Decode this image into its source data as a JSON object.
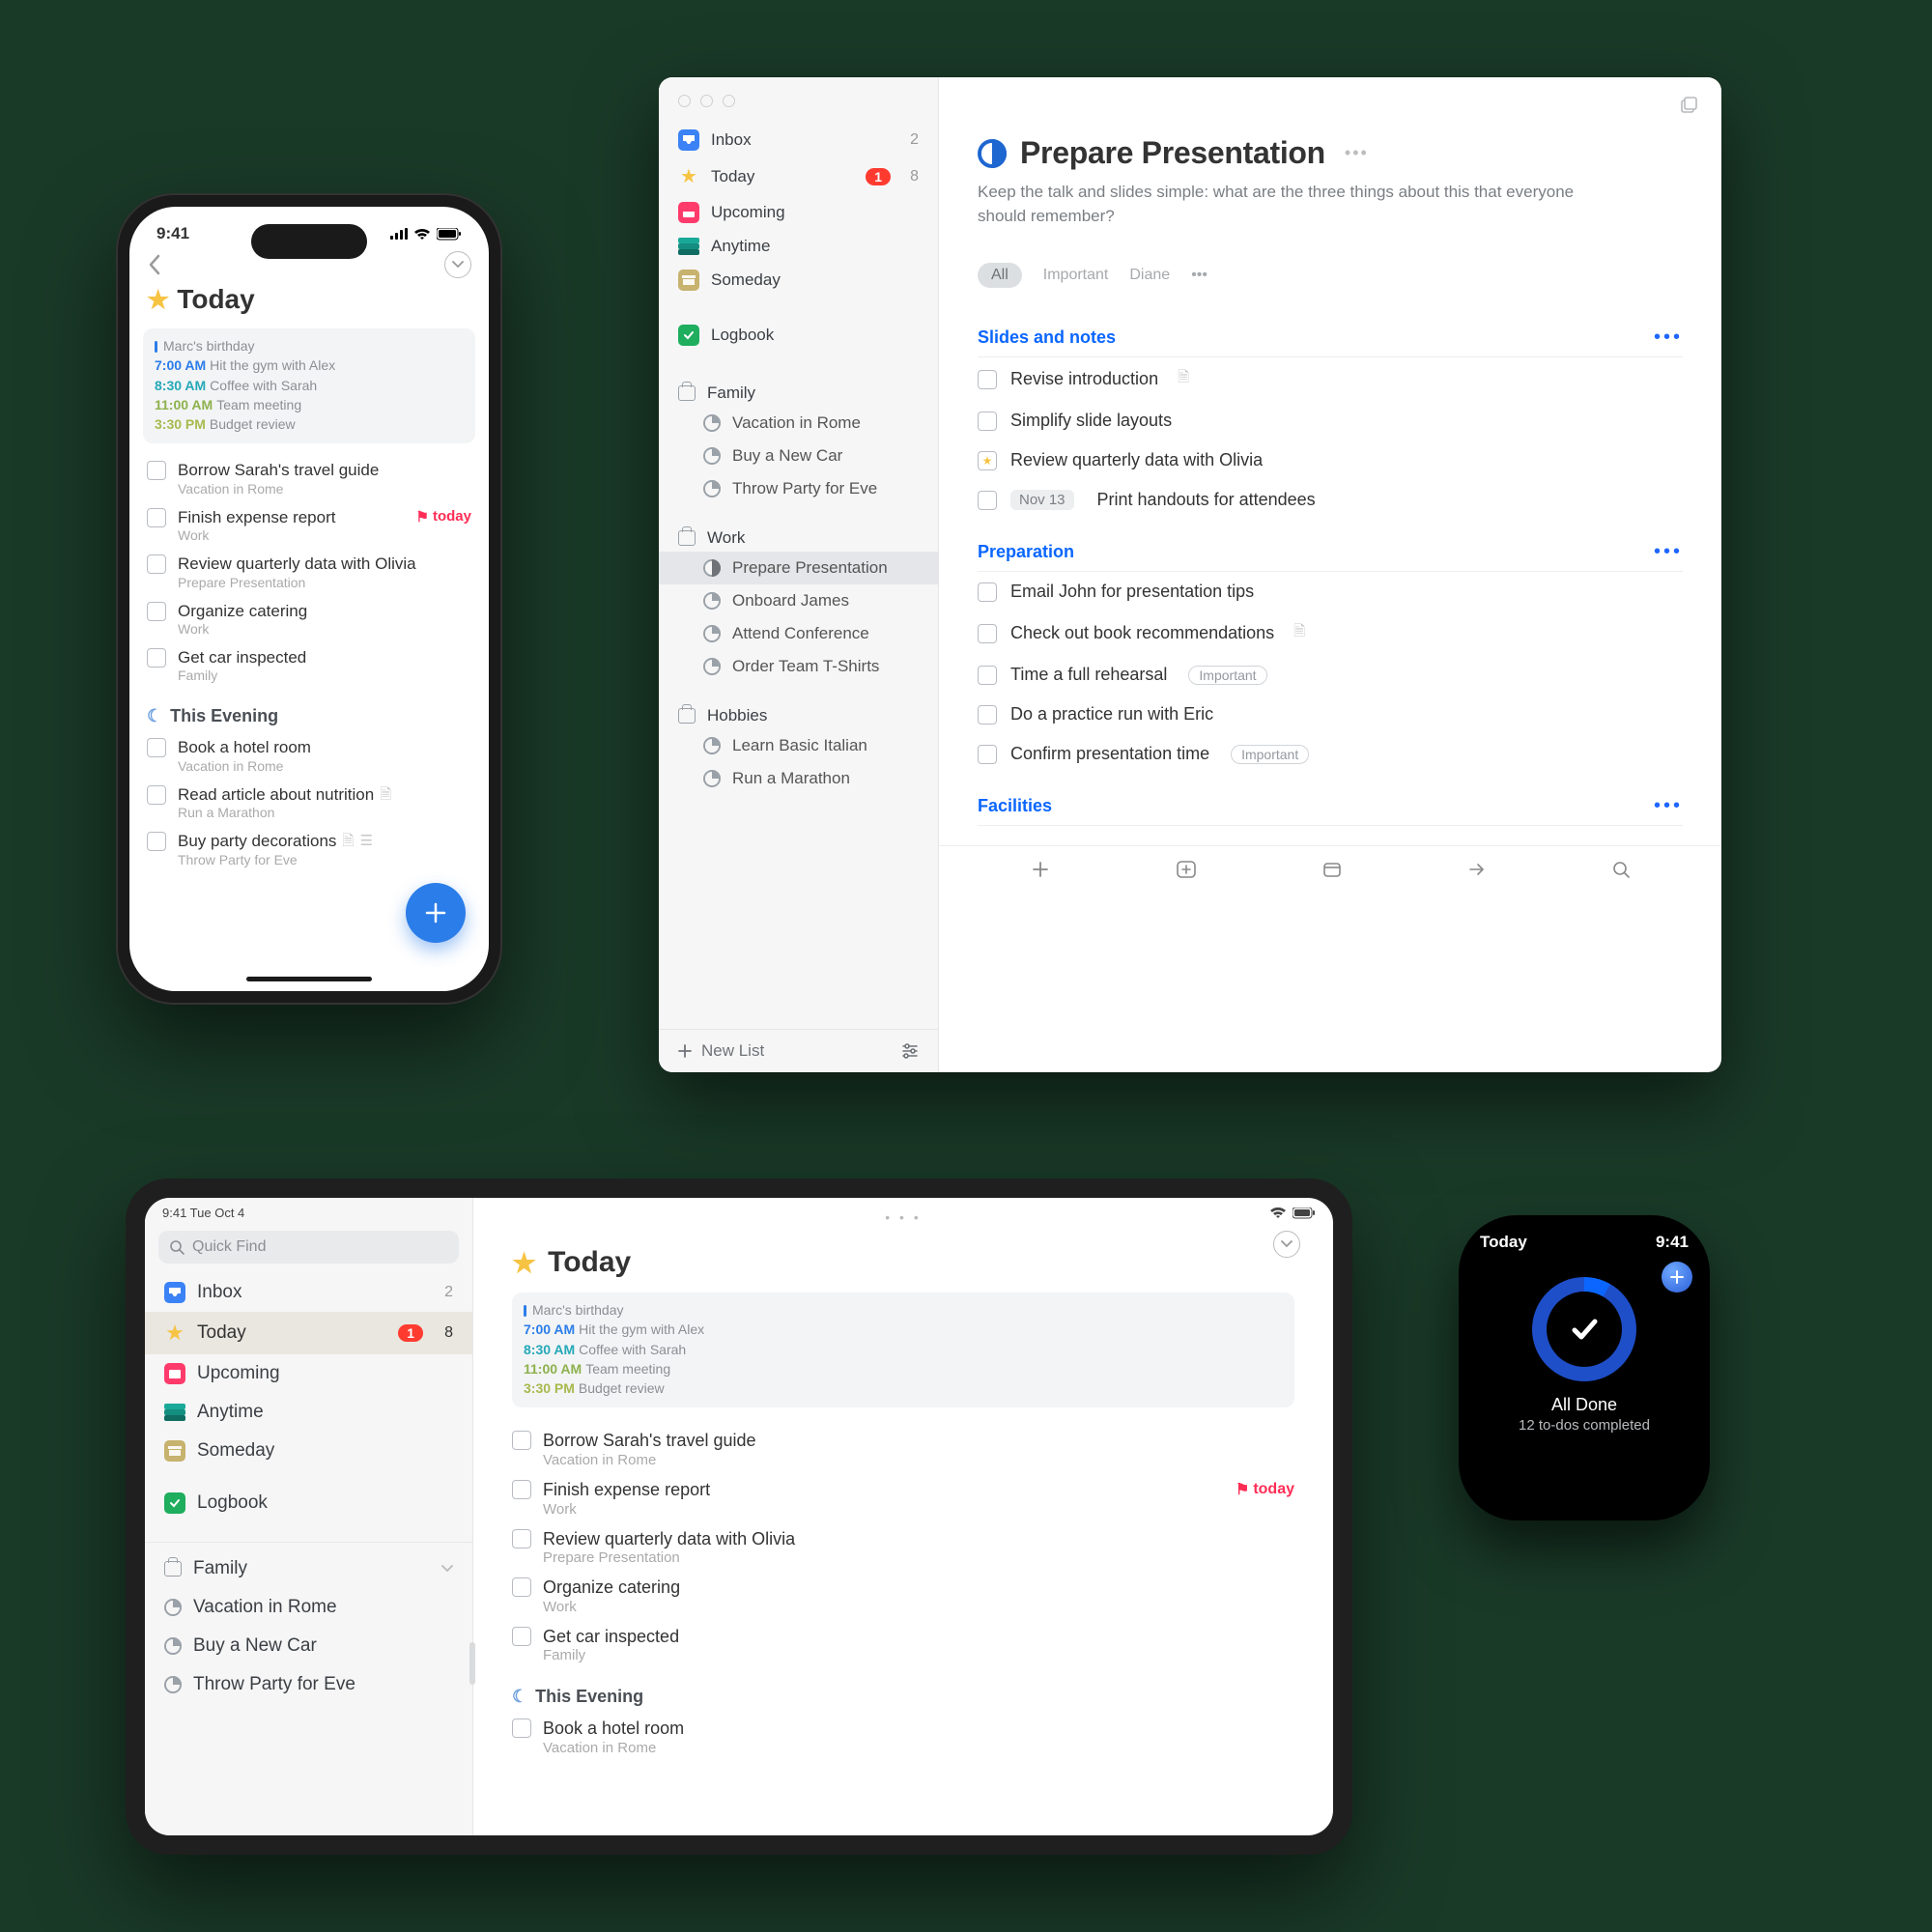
{
  "phone": {
    "clock": "9:41",
    "title": "Today",
    "events": {
      "allday": "Marc's birthday",
      "rows": [
        {
          "time": "7:00 AM",
          "label": "Hit the gym with Alex",
          "cls": "t-blue"
        },
        {
          "time": "8:30 AM",
          "label": "Coffee with Sarah",
          "cls": "t-teal"
        },
        {
          "time": "11:00 AM",
          "label": "Team meeting",
          "cls": "t-olive"
        },
        {
          "time": "3:30 PM",
          "label": "Budget review",
          "cls": "t-lime"
        }
      ]
    },
    "todos": [
      {
        "title": "Borrow Sarah's travel guide",
        "sub": "Vacation in Rome"
      },
      {
        "title": "Finish expense report",
        "sub": "Work",
        "flag": "today"
      },
      {
        "title": "Review quarterly data with Olivia",
        "sub": "Prepare Presentation"
      },
      {
        "title": "Organize catering",
        "sub": "Work"
      },
      {
        "title": "Get car inspected",
        "sub": "Family"
      }
    ],
    "evening_label": "This Evening",
    "evening": [
      {
        "title": "Book a hotel room",
        "sub": "Vacation in Rome"
      },
      {
        "title": "Read article about nutrition",
        "sub": "Run a Marathon",
        "note": true
      },
      {
        "title": "Buy party decorations",
        "sub": "Throw Party for Eve",
        "note": true,
        "list": true
      }
    ]
  },
  "mac": {
    "sidebar": {
      "inbox": "Inbox",
      "inbox_count": "2",
      "today": "Today",
      "today_badge": "1",
      "today_count": "8",
      "upcoming": "Upcoming",
      "anytime": "Anytime",
      "someday": "Someday",
      "logbook": "Logbook",
      "areas": [
        {
          "name": "Family",
          "projects": [
            "Vacation in Rome",
            "Buy a New Car",
            "Throw Party for Eve"
          ]
        },
        {
          "name": "Work",
          "projects": [
            "Prepare Presentation",
            "Onboard James",
            "Attend Conference",
            "Order Team T-Shirts"
          ],
          "selected": 0
        },
        {
          "name": "Hobbies",
          "projects": [
            "Learn Basic Italian",
            "Run a Marathon"
          ]
        }
      ],
      "new_list": "New List"
    },
    "project": {
      "title": "Prepare Presentation",
      "desc": "Keep the talk and slides simple: what are the three things about this that everyone should remember?",
      "filters": {
        "all": "All",
        "f1": "Important",
        "f2": "Diane"
      },
      "sections": [
        {
          "title": "Slides and notes",
          "rows": [
            {
              "t": "Revise introduction",
              "note": true
            },
            {
              "t": "Simplify slide layouts"
            },
            {
              "t": "Review quarterly data with Olivia",
              "star": true
            },
            {
              "t": "Print handouts for attendees",
              "date": "Nov 13"
            }
          ]
        },
        {
          "title": "Preparation",
          "rows": [
            {
              "t": "Email John for presentation tips"
            },
            {
              "t": "Check out book recommendations",
              "note": true
            },
            {
              "t": "Time a full rehearsal",
              "tag": "Important"
            },
            {
              "t": "Do a practice run with Eric"
            },
            {
              "t": "Confirm presentation time",
              "tag": "Important"
            }
          ]
        },
        {
          "title": "Facilities",
          "rows": []
        }
      ]
    }
  },
  "ipad": {
    "status_left": "9:41  Tue Oct 4",
    "quick_find": "Quick Find",
    "sidebar": {
      "inbox": "Inbox",
      "inbox_count": "2",
      "today": "Today",
      "today_badge": "1",
      "today_count": "8",
      "upcoming": "Upcoming",
      "anytime": "Anytime",
      "someday": "Someday",
      "logbook": "Logbook",
      "area": "Family",
      "projects": [
        "Vacation in Rome",
        "Buy a New Car",
        "Throw Party for Eve"
      ]
    },
    "title": "Today",
    "events": {
      "allday": "Marc's birthday",
      "rows": [
        {
          "time": "7:00 AM",
          "label": "Hit the gym with Alex",
          "cls": "t-blue"
        },
        {
          "time": "8:30 AM",
          "label": "Coffee with Sarah",
          "cls": "t-teal"
        },
        {
          "time": "11:00 AM",
          "label": "Team meeting",
          "cls": "t-olive"
        },
        {
          "time": "3:30 PM",
          "label": "Budget review",
          "cls": "t-lime"
        }
      ]
    },
    "todos": [
      {
        "title": "Borrow Sarah's travel guide",
        "sub": "Vacation in Rome"
      },
      {
        "title": "Finish expense report",
        "sub": "Work",
        "flag": "today"
      },
      {
        "title": "Review quarterly data with Olivia",
        "sub": "Prepare Presentation"
      },
      {
        "title": "Organize catering",
        "sub": "Work"
      },
      {
        "title": "Get car inspected",
        "sub": "Family"
      }
    ],
    "evening_label": "This Evening",
    "evening": [
      {
        "title": "Book a hotel room",
        "sub": "Vacation in Rome"
      }
    ]
  },
  "watch": {
    "title": "Today",
    "time": "9:41",
    "done": "All Done",
    "sub": "12 to-dos completed"
  }
}
